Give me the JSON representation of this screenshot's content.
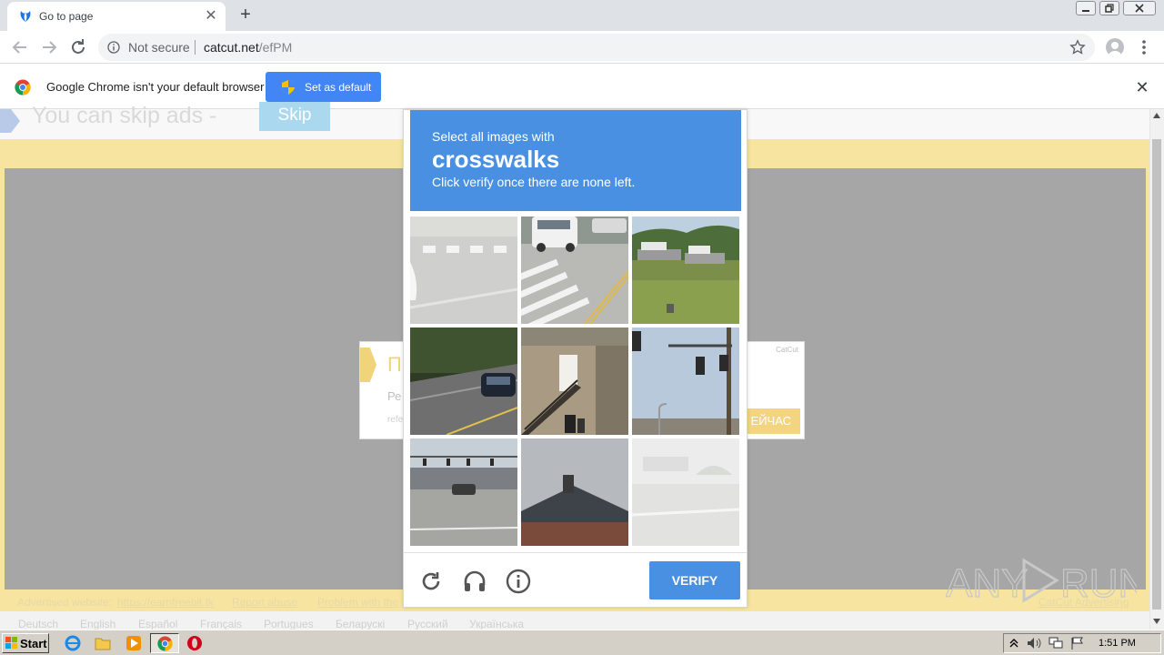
{
  "browser": {
    "tab_title": "Go to page",
    "close_tab": "✕",
    "new_tab": "+",
    "security_label": "Not secure",
    "url_host": "catcut.net",
    "url_path": "/efPM",
    "infobar_text": "Google Chrome isn't your default browser",
    "set_default_label": "Set as default",
    "infobar_close": "✕"
  },
  "page": {
    "skip_text": "You can skip ads  -",
    "skip_button": "Skip",
    "ad": {
      "title": "П",
      "line1": "Ре",
      "line2": "refe",
      "brand": "CatCut",
      "cta": "ЕЙЧАС"
    },
    "footer": {
      "advertised_label": "Advertised website:",
      "advertised_link": "https://earnfreebit.tk",
      "report": "Report abuse",
      "problem": "Problem with the",
      "advertising": "CatCut Advertising"
    },
    "languages": [
      "Deutsch",
      "English",
      "Español",
      "Français",
      "Portugues",
      "Беларускі",
      "Русский",
      "Українська"
    ]
  },
  "captcha": {
    "instruction_top": "Select all images with",
    "keyword": "crosswalks",
    "instruction_bottom": "Click verify once there are none left.",
    "tiles": [
      "crosswalk-corner",
      "crosswalk-van",
      "boats-field",
      "car-road",
      "building-stairs",
      "traffic-lights",
      "intersection-road",
      "house-roof",
      "faded-street"
    ],
    "verify_label": "VERIFY"
  },
  "taskbar": {
    "start_label": "Start",
    "clock": "1:51 PM"
  },
  "watermark": "ANY RUN",
  "colors": {
    "captcha_blue": "#4a90e2",
    "chrome_blue": "#4285f4",
    "page_yellow": "#f7e4a1"
  }
}
